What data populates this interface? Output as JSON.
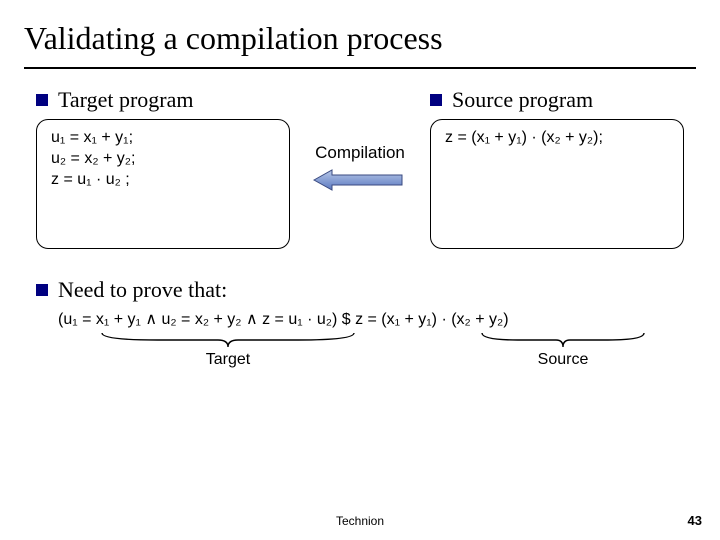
{
  "title": "Validating a compilation process",
  "left": {
    "heading": "Target program",
    "lines": [
      "u₁ = x₁ + y₁;",
      "u₂ = x₂ + y₂;",
      "z = u₁ · u₂ ;"
    ]
  },
  "mid": {
    "label": "Compilation"
  },
  "right": {
    "heading": "Source program",
    "lines": [
      "z = (x₁ + y₁) · (x₂ + y₂);"
    ]
  },
  "prove": {
    "heading": "Need to prove that:",
    "formula": "(u₁ = x₁ + y₁ ∧ u₂ = x₂ + y₂  ∧  z = u₁ · u₂)  $   z = (x₁ + y₁) · (x₂ + y₂)",
    "brace_left": "Target",
    "brace_right": "Source"
  },
  "footer": {
    "org": "Technion",
    "page": "43"
  }
}
